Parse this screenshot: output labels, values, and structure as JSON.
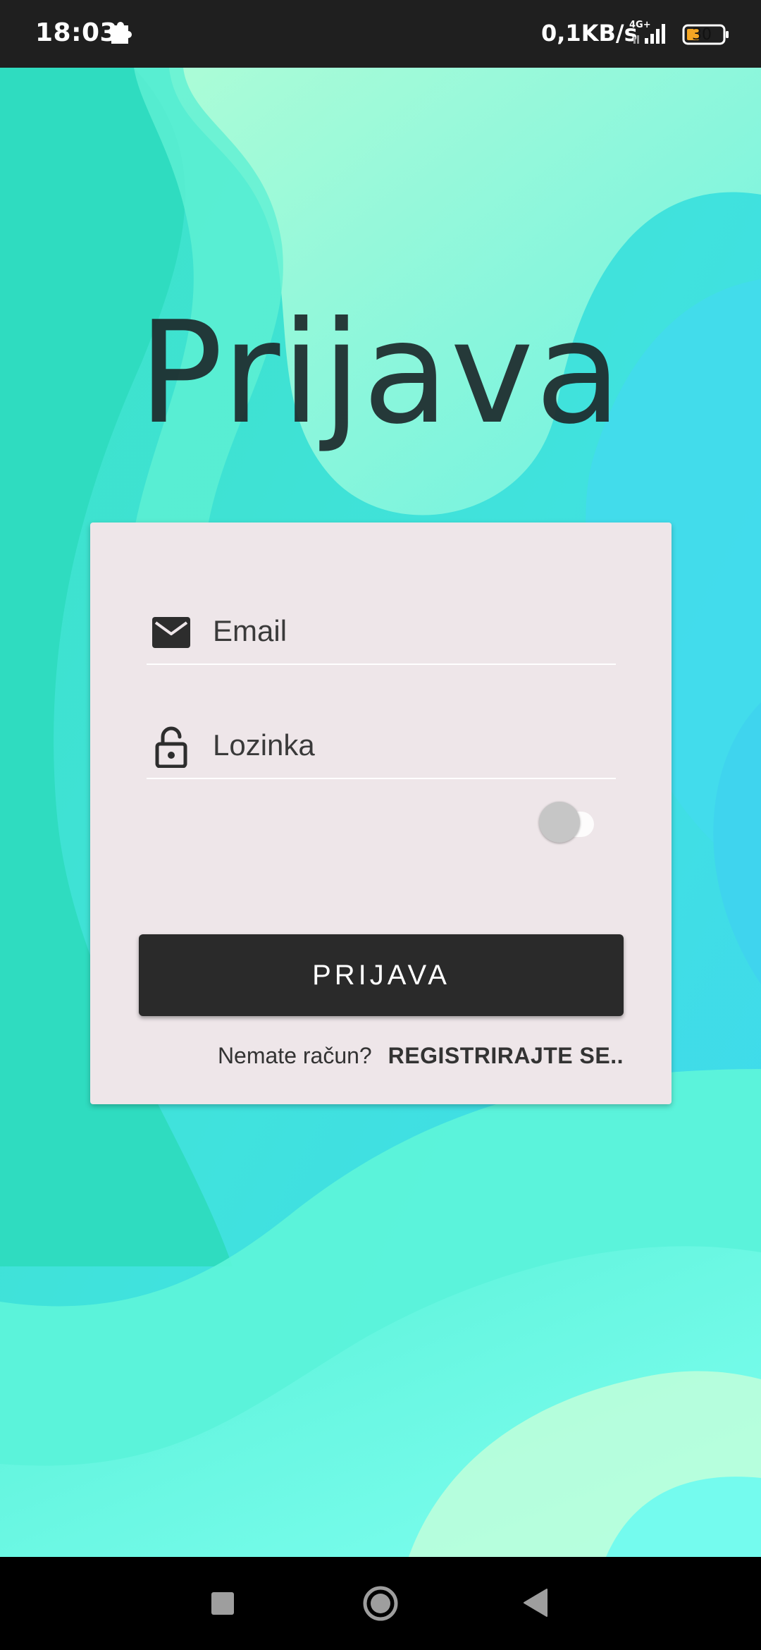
{
  "status_bar": {
    "time": "18:03",
    "speed": "0,1KB/s",
    "network": "4G+",
    "battery": "30",
    "icons": [
      "puzzle-icon",
      "signal-icon",
      "battery-icon"
    ]
  },
  "screen": {
    "title": "Prijava"
  },
  "form": {
    "email_placeholder": "Email",
    "password_placeholder": "Lozinka",
    "show_password_toggle": "off",
    "login_button": "PRIJAVA",
    "register_question": "Nemate račun?",
    "register_link": "REGISTRIRAJTE SE.."
  },
  "nav_bar": {
    "icons": [
      "recent-apps-icon",
      "home-icon",
      "back-icon"
    ]
  },
  "colors": {
    "card_background": "#eee6e9",
    "button_background": "#2a2a2a",
    "accent_teal": "#3fe3d6",
    "accent_blue": "#3cd4ec"
  }
}
